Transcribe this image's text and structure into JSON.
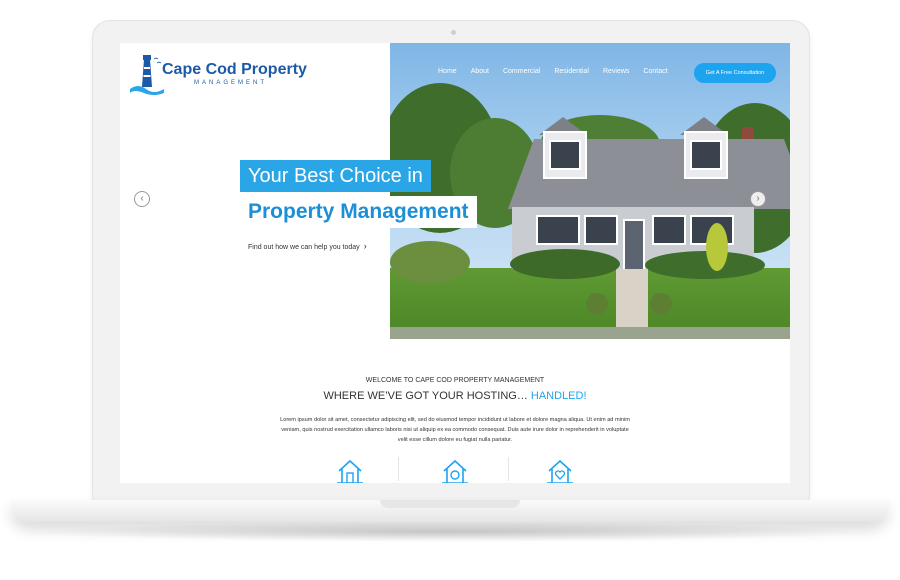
{
  "brand": {
    "title": "Cape Cod Property",
    "subtitle": "MANAGEMENT",
    "color": "#1c5aa8"
  },
  "nav": {
    "items": [
      "Home",
      "About",
      "Commercial",
      "Residential",
      "Reviews",
      "Contact"
    ],
    "cta": "Get A Free Consultation",
    "cta_color": "#1ea3ef"
  },
  "hero": {
    "headline_line1": "Your Best Choice in",
    "headline_line2": "Property Management",
    "link_text": "Find out how we can help you today",
    "link_arrow": "›",
    "prev_arrow": "‹",
    "next_arrow": "›",
    "accent_color": "#2aa5e6"
  },
  "content": {
    "welcome": "WELCOME TO CAPE COD PROPERTY MANAGEMENT",
    "tagline_main": "WHERE WE’VE GOT YOUR HOSTING… ",
    "tagline_highlight": "HANDLED!",
    "lorem": "Lorem ipsum dolor sit amet, consectetur adipiscing elit, sed do eiusmod tempor incididunt ut labore et dolore magna aliqua. Ut enim ad minim veniam, quis nostrud exercitation ullamco laboris nisi ut aliquip ex ea commodo consequat. Duis aute irure dolor in reprehenderit in voluptate velit esse cillum dolore eu fugiat nulla pariatur."
  },
  "features": {
    "icons": [
      "house-icon",
      "house-search-icon",
      "house-heart-icon"
    ]
  }
}
